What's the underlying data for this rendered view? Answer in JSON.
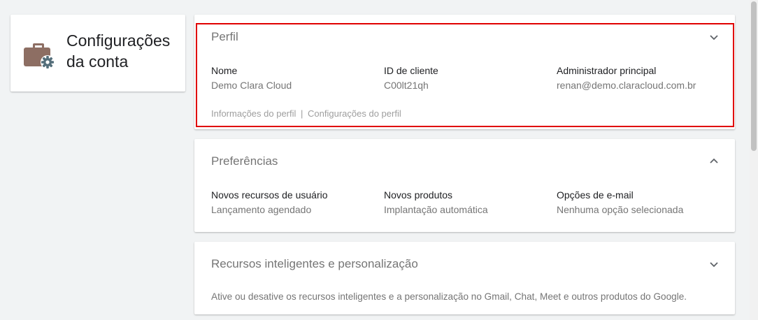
{
  "account_card": {
    "title": "Configurações da conta",
    "icon": "briefcase-gear-icon",
    "icon_color": "#8d6e63"
  },
  "profile": {
    "title": "Perfil",
    "expanded": false,
    "fields": [
      {
        "label": "Nome",
        "value": "Demo Clara Cloud"
      },
      {
        "label": "ID de cliente",
        "value": "C00lt21qh"
      },
      {
        "label": "Administrador principal",
        "value": "renan@demo.claracloud.com.br"
      }
    ],
    "link_info": "Informações do perfil",
    "link_separator": "|",
    "link_settings": "Configurações do perfil"
  },
  "preferences": {
    "title": "Preferências",
    "expanded": true,
    "fields": [
      {
        "label": "Novos recursos de usuário",
        "value": "Lançamento agendado"
      },
      {
        "label": "Novos produtos",
        "value": "Implantação automática"
      },
      {
        "label": "Opções de e-mail",
        "value": "Nenhuma opção selecionada"
      }
    ]
  },
  "smart_features": {
    "title": "Recursos inteligentes e personalização",
    "expanded": false,
    "description": "Ative ou desative os recursos inteligentes e a personalização no Gmail, Chat, Meet e outros produtos do Google."
  },
  "colors": {
    "highlight": "#e00000",
    "background": "#f1f3f4"
  }
}
